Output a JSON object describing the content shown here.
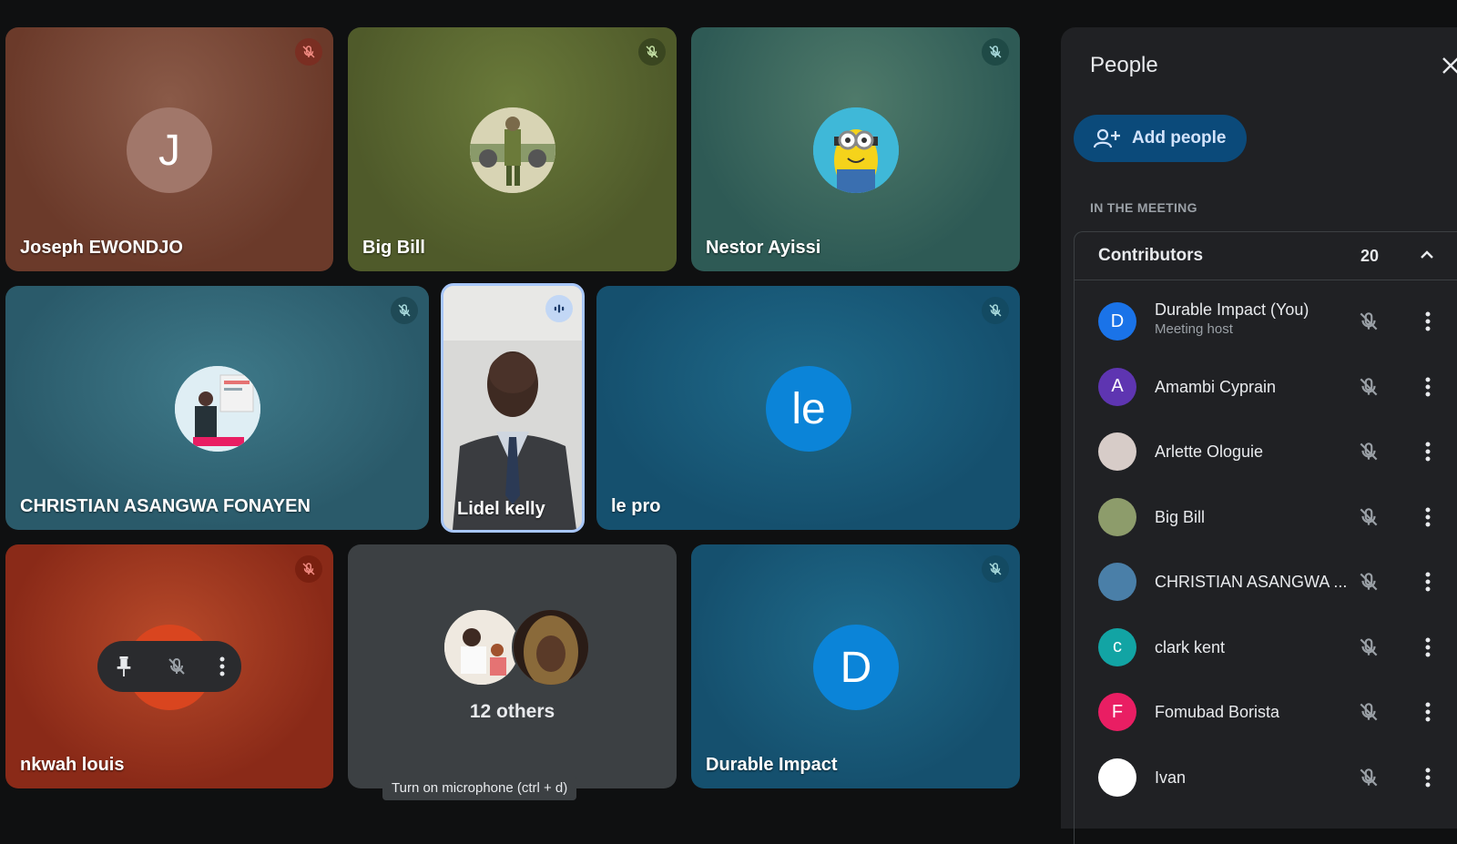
{
  "tiles": {
    "joseph": {
      "name": "Joseph EWONDJO",
      "initial": "J"
    },
    "bigbill": {
      "name": "Big Bill"
    },
    "nestor": {
      "name": "Nestor Ayissi"
    },
    "christian": {
      "name": "CHRISTIAN ASANGWA FONAYEN"
    },
    "lidel": {
      "name": "Lidel kelly"
    },
    "lepro": {
      "name": "le pro",
      "initial": "le"
    },
    "nkwah": {
      "name": "nkwah louis"
    },
    "others": {
      "label": "12 others"
    },
    "durable": {
      "name": "Durable Impact",
      "initial": "D"
    }
  },
  "tooltip": "Turn on microphone (ctrl + d)",
  "panel": {
    "title": "People",
    "add_people": "Add people",
    "section": "IN THE MEETING",
    "group_title": "Contributors",
    "group_count": "20",
    "participants": [
      {
        "name": "Durable Impact (You)",
        "sub": "Meeting host",
        "initial": "D",
        "color": "#1a73e8"
      },
      {
        "name": "Amambi Cyprain",
        "initial": "A",
        "color": "#5e35b1"
      },
      {
        "name": "Arlette Ologuie",
        "initial": "",
        "color": "#d7ccc8"
      },
      {
        "name": "Big Bill",
        "initial": "",
        "color": "#8d9c6b"
      },
      {
        "name": "CHRISTIAN ASANGWA ...",
        "initial": "",
        "color": "#4a7fa8"
      },
      {
        "name": "clark kent",
        "initial": "c",
        "color": "#12a4a4"
      },
      {
        "name": "Fomubad Borista",
        "initial": "F",
        "color": "#e91e63"
      },
      {
        "name": "Ivan",
        "initial": "",
        "color": "#ffffff"
      }
    ]
  },
  "colors": {
    "accent": "#8ab4f8",
    "muted_red": "#ea4335"
  }
}
